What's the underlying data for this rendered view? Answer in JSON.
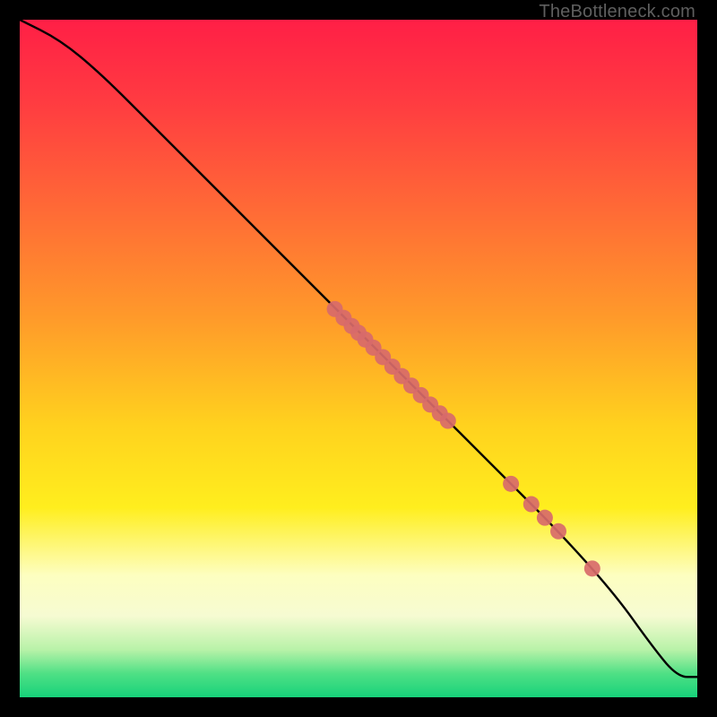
{
  "watermark": "TheBottleneck.com",
  "gradient_stops": [
    {
      "offset": 0.0,
      "color": "#ff1f46"
    },
    {
      "offset": 0.12,
      "color": "#ff3b41"
    },
    {
      "offset": 0.28,
      "color": "#ff6a36"
    },
    {
      "offset": 0.44,
      "color": "#ff9a2a"
    },
    {
      "offset": 0.6,
      "color": "#ffd21e"
    },
    {
      "offset": 0.72,
      "color": "#ffee1e"
    },
    {
      "offset": 0.82,
      "color": "#fdfec0"
    },
    {
      "offset": 0.88,
      "color": "#f6fbd2"
    },
    {
      "offset": 0.93,
      "color": "#b8f2a8"
    },
    {
      "offset": 0.965,
      "color": "#4fe085"
    },
    {
      "offset": 1.0,
      "color": "#17d27a"
    }
  ],
  "chart_data": {
    "type": "line",
    "title": "",
    "xlabel": "",
    "ylabel": "",
    "xlim": [
      0,
      100
    ],
    "ylim": [
      0,
      100
    ],
    "series": [
      {
        "name": "curve",
        "x": [
          0,
          6,
          12,
          20,
          30,
          40,
          50,
          60,
          70,
          80,
          88,
          93,
          97,
          100
        ],
        "y": [
          100,
          97,
          92,
          84,
          74,
          64,
          54,
          44,
          34,
          24,
          15,
          8,
          3,
          3
        ]
      }
    ],
    "markers": {
      "name": "highlight-points",
      "color": "#d86a6a",
      "radius": 9,
      "points": [
        {
          "x": 46.5,
          "y": 57.3
        },
        {
          "x": 47.8,
          "y": 56.0
        },
        {
          "x": 49.0,
          "y": 54.8
        },
        {
          "x": 50.0,
          "y": 53.8
        },
        {
          "x": 51.0,
          "y": 52.8
        },
        {
          "x": 52.2,
          "y": 51.6
        },
        {
          "x": 53.6,
          "y": 50.2
        },
        {
          "x": 55.0,
          "y": 48.8
        },
        {
          "x": 56.4,
          "y": 47.4
        },
        {
          "x": 57.8,
          "y": 46.0
        },
        {
          "x": 59.2,
          "y": 44.6
        },
        {
          "x": 60.6,
          "y": 43.2
        },
        {
          "x": 62.0,
          "y": 41.9
        },
        {
          "x": 63.2,
          "y": 40.8
        },
        {
          "x": 72.5,
          "y": 31.5
        },
        {
          "x": 75.5,
          "y": 28.5
        },
        {
          "x": 77.5,
          "y": 26.5
        },
        {
          "x": 79.5,
          "y": 24.5
        },
        {
          "x": 84.5,
          "y": 19.0
        }
      ]
    }
  }
}
